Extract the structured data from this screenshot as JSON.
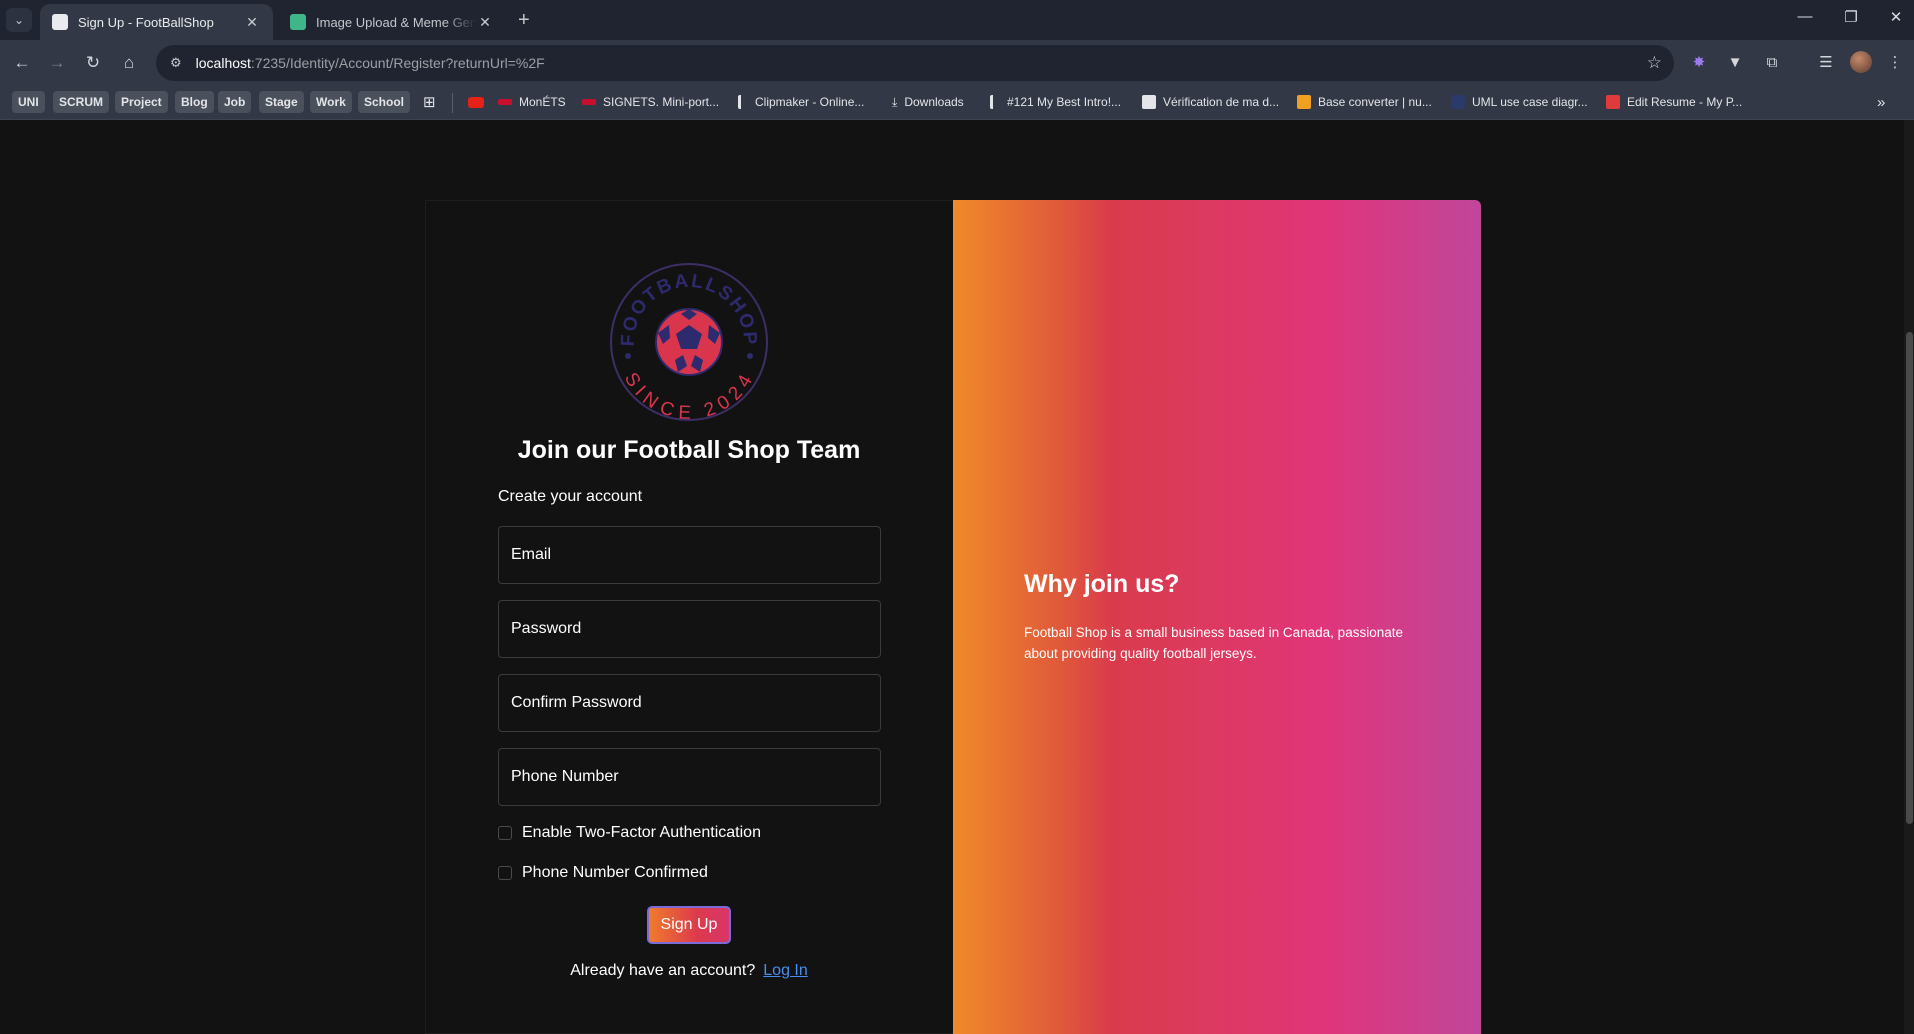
{
  "browser": {
    "tabs": [
      {
        "title": "Sign Up - FootBallShop",
        "active": true
      },
      {
        "title": "Image Upload & Meme Generator",
        "active": false
      }
    ],
    "url_host": "localhost",
    "url_path": ":7235/Identity/Account/Register?returnUrl=%2F",
    "bookmark_folders": [
      "UNI",
      "SCRUM",
      "Project",
      "Blog",
      "Job",
      "Stage",
      "Work",
      "School"
    ],
    "bookmarks": [
      {
        "label": "MonÉTS"
      },
      {
        "label": "SIGNETS. Mini-port..."
      },
      {
        "label": "Clipmaker - Online..."
      },
      {
        "label": "Downloads"
      },
      {
        "label": "#121 My Best Intro!..."
      },
      {
        "label": "Vérification de ma d..."
      },
      {
        "label": "Base converter | nu..."
      },
      {
        "label": "UML use case diagr..."
      },
      {
        "label": "Edit Resume - My P..."
      }
    ]
  },
  "logo": {
    "top_text": "FOOTBALLSHOP",
    "bottom_text": "SINCE 2024",
    "colors": {
      "ring": "#3d2f66",
      "red": "#d9364e",
      "navy": "#2e2a6e"
    }
  },
  "form": {
    "title": "Join our Football Shop Team",
    "subtitle": "Create your account",
    "email_placeholder": "Email",
    "password_placeholder": "Password",
    "confirm_placeholder": "Confirm Password",
    "phone_placeholder": "Phone Number",
    "two_factor_label": "Enable Two-Factor Authentication",
    "phone_confirmed_label": "Phone Number Confirmed",
    "submit_label": "Sign Up",
    "login_prompt": "Already have an account?",
    "login_link": "Log In"
  },
  "info": {
    "title": "Why join us?",
    "text": "Football Shop is a small business based in Canada, passionate about providing quality football jerseys."
  },
  "colors": {
    "accent_orange": "#f08a2a",
    "accent_pink": "#e0357a",
    "link": "#4a8df0"
  }
}
